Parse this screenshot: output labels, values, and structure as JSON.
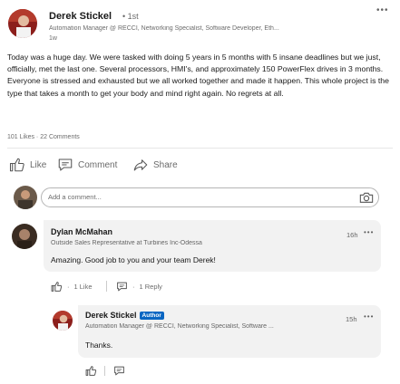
{
  "post": {
    "author_name": "Derek Stickel",
    "degree": "• 1st",
    "headline": "Automation Manager @ RECCI, Networking Specialist, Software Developer, Eth...",
    "time": "1w",
    "text": "Today was a huge day. We were tasked with doing 5 years in 5 months with 5 insane deadlines but we just, officially, met the last one. Several processors, HMI's, and approximately 150 PowerFlex drives in 3 months. Everyone is stressed and exhausted but we all worked together and made it happen. This whole project is the type that takes a month to get your body and mind right again. No regrets at all.",
    "likes": "101 Likes",
    "separator": "·",
    "comments_count": "22 Comments"
  },
  "actions": {
    "like": "Like",
    "comment": "Comment",
    "share": "Share"
  },
  "composer": {
    "placeholder": "Add a comment..."
  },
  "comments": [
    {
      "author_name": "Dylan McMahan",
      "headline": "Outside Sales Representative at Turbines Inc-Odessa",
      "time": "16h",
      "text": "Amazing. Good job to you and your team Derek!",
      "likes": "1 Like",
      "replies": "1 Reply"
    }
  ],
  "reply": {
    "author_name": "Derek Stickel",
    "badge": "Author",
    "headline": "Automation Manager @ RECCI, Networking Specialist, Software ...",
    "time": "15h",
    "text": "Thanks."
  },
  "colors": {
    "brand_blue": "#0a66c2",
    "muted_text": "#666666",
    "bubble_bg": "#f2f2f2"
  },
  "icons": [
    "more-icon",
    "like-icon",
    "comment-icon",
    "share-icon",
    "camera-icon"
  ]
}
